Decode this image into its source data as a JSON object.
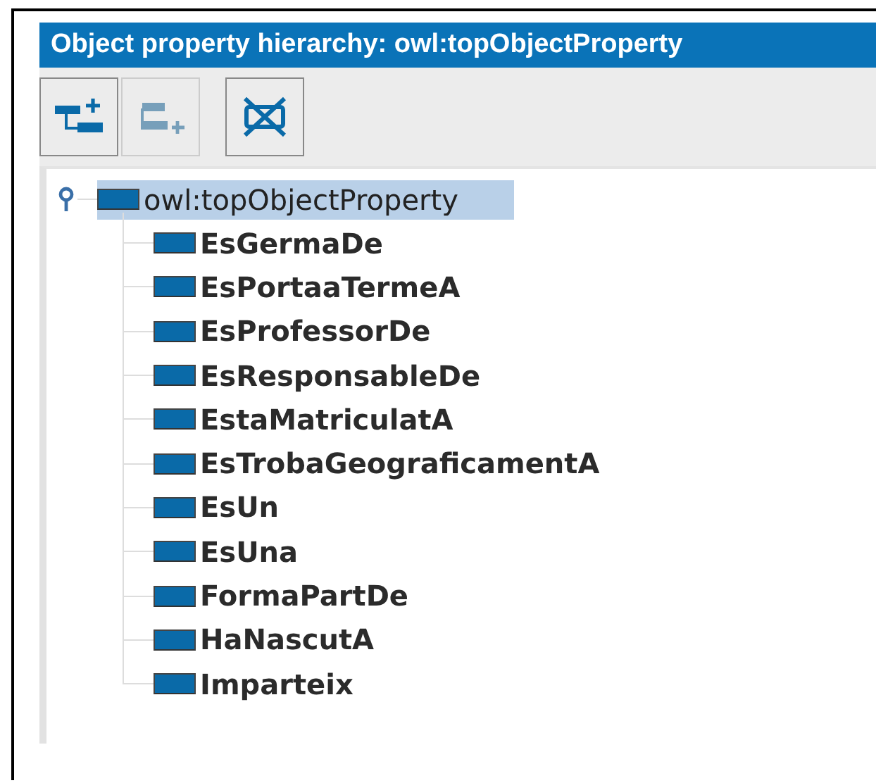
{
  "panel": {
    "title": "Object property hierarchy: owl:topObjectProperty"
  },
  "toolbar": [
    {
      "kind": "add-sub",
      "disabled": false
    },
    {
      "kind": "add-sibling",
      "disabled": true
    },
    {
      "kind": "delete",
      "disabled": false
    }
  ],
  "tree": {
    "label": "owl:topObjectProperty",
    "selected": true,
    "expanded": true,
    "children": [
      {
        "label": "EsGermaDe",
        "selected": false
      },
      {
        "label": "EsPortaaTermeA",
        "selected": false
      },
      {
        "label": "EsProfessorDe",
        "selected": false
      },
      {
        "label": "EsResponsableDe",
        "selected": false
      },
      {
        "label": "EstaMatriculatA",
        "selected": false
      },
      {
        "label": "EsTrobaGeograficamentA",
        "selected": false
      },
      {
        "label": "EsUn",
        "selected": false
      },
      {
        "label": "EsUna",
        "selected": false
      },
      {
        "label": "FormaPartDe",
        "selected": false
      },
      {
        "label": "HaNascutA",
        "selected": false
      },
      {
        "label": "Imparteix",
        "selected": false
      }
    ]
  }
}
